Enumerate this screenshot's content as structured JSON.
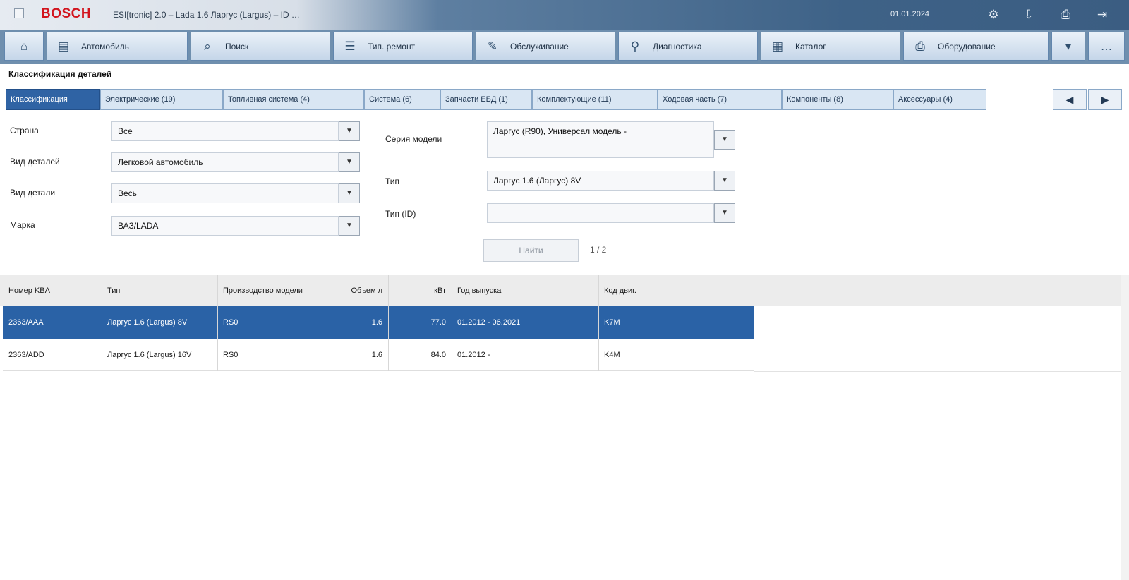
{
  "titlebar": {
    "brand": "BOSCH",
    "title": "ESI[tronic] 2.0 – Lada 1.6 Ларгус (Largus) – ID …",
    "right_text": "01.01.2024",
    "buttons": [
      "gear-icon",
      "download-icon",
      "print-icon",
      "exit-icon"
    ]
  },
  "toolbar": {
    "home_icon": "⌂",
    "items": [
      {
        "icon": "▤",
        "label": "Автомобиль"
      },
      {
        "icon": "⌕",
        "label": "Поиск"
      },
      {
        "icon": "☰",
        "label": "Тип. ремонт"
      },
      {
        "icon": "✎",
        "label": "Обслуживание"
      },
      {
        "icon": "⚲",
        "label": "Диагностика"
      },
      {
        "icon": "▦",
        "label": "Каталог"
      },
      {
        "icon": "⎙",
        "label": "Оборудование"
      }
    ],
    "extra_1": "▾",
    "extra_2": "…"
  },
  "breadcrumb": "Классификация деталей",
  "tabs": [
    {
      "label": "Классификация",
      "active": true
    },
    {
      "label": "Электрические (19)",
      "active": false
    },
    {
      "label": "Топливная система (4)",
      "active": false
    },
    {
      "label": "Система (6)",
      "active": false
    },
    {
      "label": "Запчасти ЕБД (1)",
      "active": false
    },
    {
      "label": "Комплектующие (11)",
      "active": false
    },
    {
      "label": "Ходовая часть (7)",
      "active": false
    },
    {
      "label": "Компоненты (8)",
      "active": false
    },
    {
      "label": "Аксессуары (4)",
      "active": false
    }
  ],
  "tab_nav": {
    "prev": "◀",
    "next": "▶"
  },
  "filters": {
    "left": [
      {
        "label": "Страна",
        "value": "Все"
      },
      {
        "label": "Вид деталей",
        "value": "Легковой автомобиль"
      },
      {
        "label": "Вид детали",
        "value": "Весь"
      },
      {
        "label": "Марка",
        "value": "ВАЗ/LADA"
      }
    ],
    "right": [
      {
        "label": "Серия модели",
        "value": "Ларгус (R90), Универсал модель -"
      },
      {
        "label": "Тип",
        "value": "Ларгус 1.6 (Ларгус) 8V"
      },
      {
        "label": "Тип (ID)",
        "value": ""
      }
    ],
    "go_label": "Найти",
    "pager": "1 / 2"
  },
  "table": {
    "columns": [
      "Номер KBA",
      "Тип",
      "Производство модели",
      "Объем л",
      "кВт",
      "Год выпуска",
      "Код двиг."
    ],
    "rows": [
      {
        "kba": "2363/AAA",
        "type": "Ларгус 1.6 (Largus) 8V",
        "prod": "RS0",
        "vol": "1.6",
        "kw": "77.0",
        "year": "01.2012 - 06.2021",
        "engine": "K7M",
        "selected": true
      },
      {
        "kba": "2363/ADD",
        "type": "Ларгус 1.6 (Largus) 16V",
        "prod": "RS0",
        "vol": "1.6",
        "kw": "84.0",
        "year": "01.2012 -",
        "engine": "K4M",
        "selected": false
      }
    ]
  }
}
